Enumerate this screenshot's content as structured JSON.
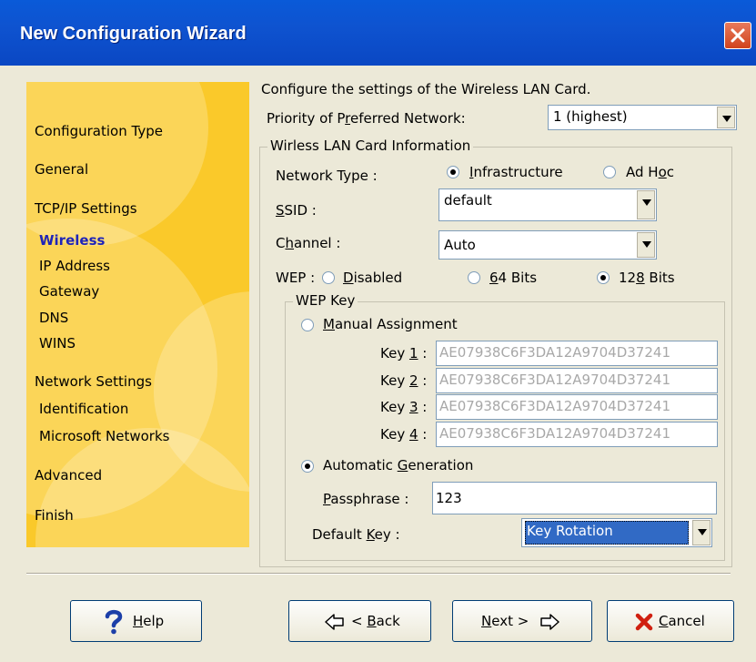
{
  "window": {
    "title": "New Configuration Wizard"
  },
  "intro": "Configure the settings of the Wireless LAN Card.",
  "priority": {
    "label_pre": "Priority of P",
    "label_u": "r",
    "label_post": "eferred Network:",
    "value": "1 (highest)"
  },
  "nav": {
    "configuration_type": "Configuration Type",
    "general": "General",
    "tcpip": "TCP/IP Settings",
    "wireless": "Wireless",
    "ip_address": "IP Address",
    "gateway": "Gateway",
    "dns": "DNS",
    "wins": "WINS",
    "network_settings": "Network Settings",
    "identification": "Identification",
    "microsoft_networks": "Microsoft Networks",
    "advanced": "Advanced",
    "finish": "Finish"
  },
  "card": {
    "group_title": "Wirless LAN Card Information",
    "network_type_label": "Network Type :",
    "infra_u": "I",
    "infra_rest": "nfrastructure",
    "adhoc_pre": "Ad H",
    "adhoc_u": "o",
    "adhoc_post": "c",
    "ssid_u": "S",
    "ssid_rest": "SID :",
    "ssid_value": "default",
    "channel_pre": "C",
    "channel_u": "h",
    "channel_post": "annel :",
    "channel_value": "Auto",
    "wep_label": "WEP :",
    "disabled_u": "D",
    "disabled_rest": "isabled",
    "bits64_u": "6",
    "bits64_rest": "4 Bits",
    "bits128_pre": "12",
    "bits128_u": "8",
    "bits128_post": " Bits"
  },
  "wep": {
    "group_title": "WEP Key",
    "manual_u": "M",
    "manual_rest": "anual Assignment",
    "keys": [
      {
        "pre": "Key ",
        "u": "1",
        "post": " :",
        "value": "AE07938C6F3DA12A9704D37241"
      },
      {
        "pre": "Key ",
        "u": "2",
        "post": " :",
        "value": "AE07938C6F3DA12A9704D37241"
      },
      {
        "pre": "Key ",
        "u": "3",
        "post": " :",
        "value": "AE07938C6F3DA12A9704D37241"
      },
      {
        "pre": "Key ",
        "u": "4",
        "post": " :",
        "value": "AE07938C6F3DA12A9704D37241"
      }
    ],
    "auto_pre": "Automatic ",
    "auto_u": "G",
    "auto_post": "eneration",
    "pass_u": "P",
    "pass_rest": "assphrase :",
    "pass_value": "123",
    "defkey_pre": "Default ",
    "defkey_u": "K",
    "defkey_post": "ey :",
    "defkey_value": "Key Rotation"
  },
  "buttons": {
    "help_u": "H",
    "help_rest": "elp",
    "back_pre": "< ",
    "back_u": "B",
    "back_post": "ack",
    "next_u": "N",
    "next_post": "ext >",
    "cancel_u": "C",
    "cancel_rest": "ancel"
  },
  "colors": {
    "sidebar": "#fac92a",
    "titlebar": "#0a5ad8",
    "active_nav": "#1f24b8",
    "selection": "#316ac5"
  }
}
